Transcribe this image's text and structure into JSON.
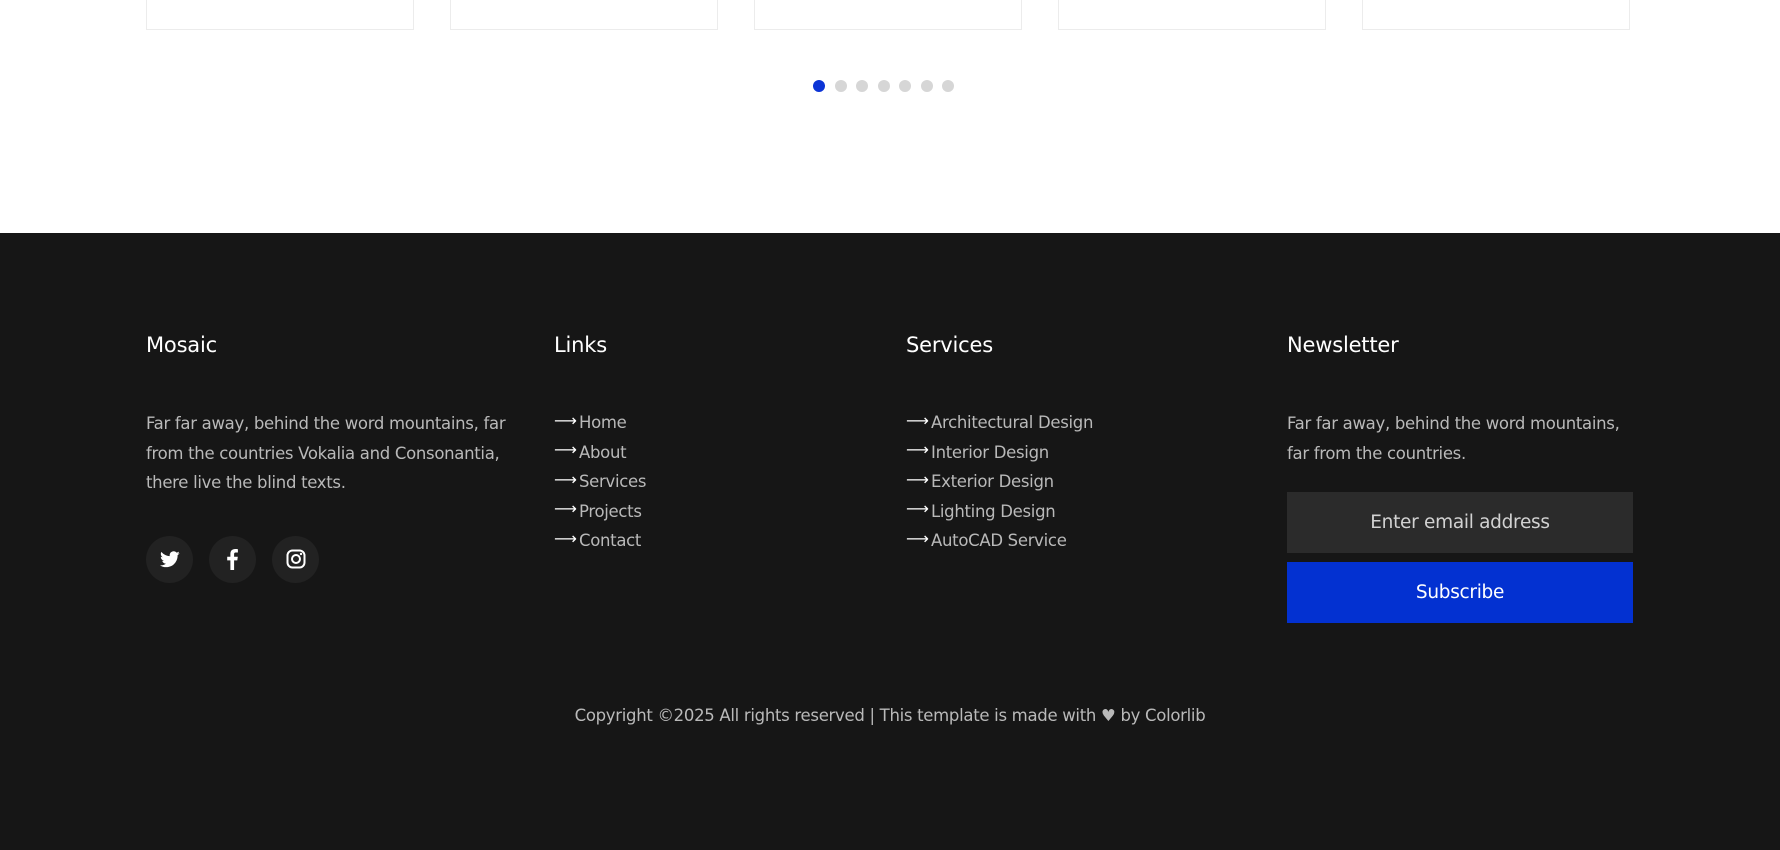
{
  "carousel": {
    "dot_count": 7,
    "active_index": 0
  },
  "footer": {
    "about": {
      "title": "Mosaic",
      "text": "Far far away, behind the word mountains, far from the countries Vokalia and Consonantia, there live the blind texts.",
      "social": [
        {
          "name": "twitter-icon"
        },
        {
          "name": "facebook-icon"
        },
        {
          "name": "instagram-icon"
        }
      ]
    },
    "links": {
      "title": "Links",
      "items": [
        "Home",
        "About",
        "Services",
        "Projects",
        "Contact"
      ]
    },
    "services": {
      "title": "Services",
      "items": [
        "Architectural Design",
        "Interior Design",
        "Exterior Design",
        "Lighting Design",
        "AutoCAD Service"
      ]
    },
    "newsletter": {
      "title": "Newsletter",
      "text": "Far far away, behind the word mountains, far from the countries.",
      "email_placeholder": "Enter email address",
      "email_value": "",
      "subscribe_label": "Subscribe"
    },
    "copyright": {
      "prefix": "Copyright ©2025 All rights reserved | This template is made with",
      "heart": "♥",
      "by": "by",
      "brand": "Colorlib"
    }
  },
  "colors": {
    "accent": "#0331d1",
    "footer_bg": "#161616",
    "text_muted": "#b9b9b9",
    "dot_active": "#0c34d6",
    "dot_inactive": "#d6d6d6"
  }
}
